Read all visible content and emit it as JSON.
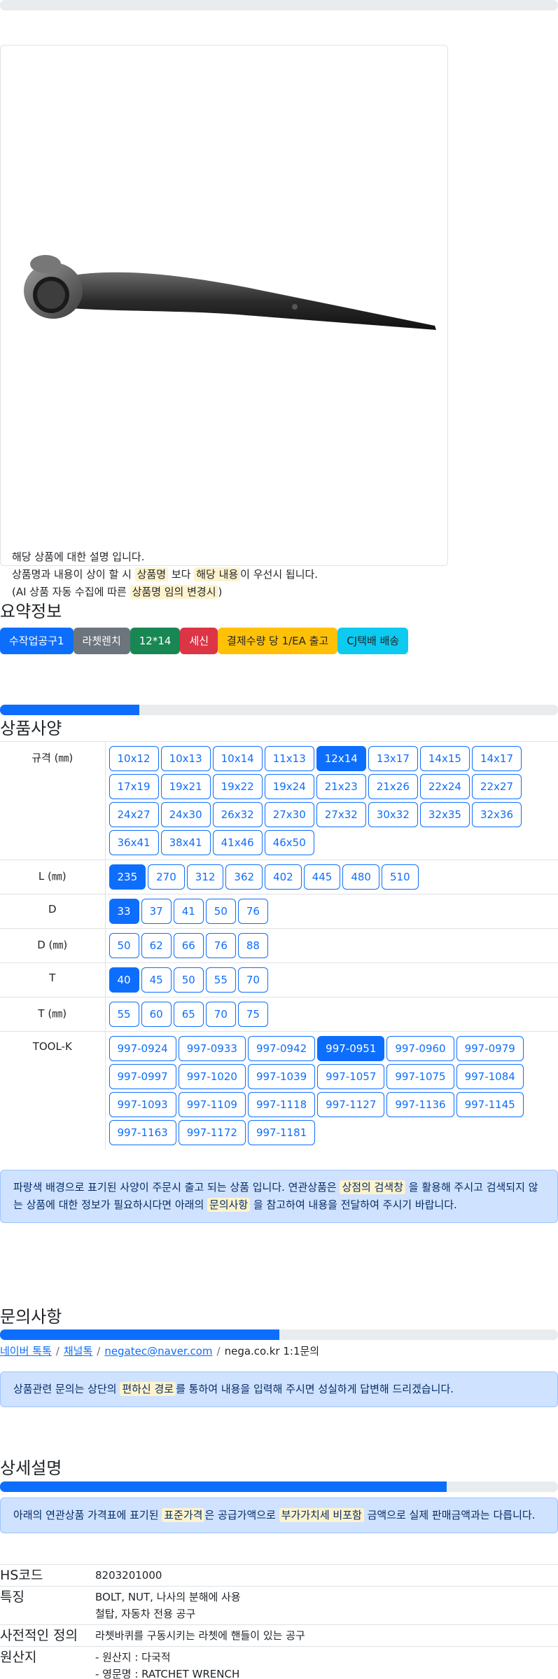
{
  "product": {
    "description_lines": [
      [
        "해당 상품에 대한 설명 입니다."
      ],
      [
        "상품명과 내용이 상이 할 시 ",
        {
          "hl": "상품명"
        },
        " 보다 ",
        {
          "hl": "해당 내용"
        },
        "이 우선시 됩니다."
      ],
      [
        "(AI 상품 자동 수집에 따른 ",
        {
          "hl": "상품명 임의 변경시"
        },
        ")"
      ]
    ]
  },
  "summary": {
    "title": "요약정보",
    "badges": [
      {
        "label": "수작업공구1",
        "style": "primary"
      },
      {
        "label": "라쳇렌치",
        "style": "secondary"
      },
      {
        "label": "12*14",
        "style": "success"
      },
      {
        "label": "세신",
        "style": "danger"
      },
      {
        "label": "결제수량 당 1/EA 출고",
        "style": "warning"
      },
      {
        "label": "CJ택배 배송",
        "style": "info"
      }
    ]
  },
  "specs": {
    "title": "상품사양",
    "progress": 0.25,
    "rows": [
      {
        "label": "규격 (㎜)",
        "options": [
          "10x12",
          "10x13",
          "10x14",
          "11x13",
          "12x14",
          "13x17",
          "14x15",
          "14x17",
          "17x19",
          "19x21",
          "19x22",
          "19x24",
          "21x23",
          "21x26",
          "22x24",
          "22x27",
          "24x27",
          "24x30",
          "26x32",
          "27x30",
          "27x32",
          "30x32",
          "32x35",
          "32x36",
          "36x41",
          "38x41",
          "41x46",
          "46x50"
        ],
        "selected": "12x14"
      },
      {
        "label": "L (㎜)",
        "options": [
          "235",
          "270",
          "312",
          "362",
          "402",
          "445",
          "480",
          "510"
        ],
        "selected": "235"
      },
      {
        "label": "D",
        "options": [
          "33",
          "37",
          "41",
          "50",
          "76"
        ],
        "selected": "33"
      },
      {
        "label": "D (㎜)",
        "options": [
          "50",
          "62",
          "66",
          "76",
          "88"
        ],
        "selected": ""
      },
      {
        "label": "T",
        "options": [
          "40",
          "45",
          "50",
          "55",
          "70"
        ],
        "selected": "40"
      },
      {
        "label": "T (㎜)",
        "options": [
          "55",
          "60",
          "65",
          "70",
          "75"
        ],
        "selected": ""
      },
      {
        "label": "TOOL-K",
        "options": [
          "997-0924",
          "997-0933",
          "997-0942",
          "997-0951",
          "997-0960",
          "997-0979",
          "997-0997",
          "997-1020",
          "997-1039",
          "997-1057",
          "997-1075",
          "997-1084",
          "997-1093",
          "997-1109",
          "997-1118",
          "997-1127",
          "997-1136",
          "997-1145",
          "997-1163",
          "997-1172",
          "997-1181"
        ],
        "selected": "997-0951"
      }
    ],
    "notice_parts": [
      "파랑색 배경으로 표기된 사양이 주문시 출고 되는 상품 입니다. 연관상품은 ",
      {
        "hl": "상점의 검색창"
      },
      " 을 활용해 주시고 검색되지 않는 상품에 대한 정보가 필요하시다면 아래의 ",
      {
        "hl": "문의사항"
      },
      " 을 참고하여 내용을 전달하여 주시기 바랍니다."
    ]
  },
  "inquiry": {
    "title": "문의사항",
    "progress": 0.5,
    "links": [
      "네이버 톡톡",
      "채널톡",
      "negatec@naver.com"
    ],
    "plain": "nega.co.kr 1:1문의",
    "notice_parts": [
      "상품관련 문의는 상단의 ",
      {
        "hl": "편하신 경로"
      },
      "를 통하여 내용을 입력해 주시면 성실하게 답변해 드리겠습니다."
    ]
  },
  "detail": {
    "title": "상세설명",
    "progress": 0.8,
    "notice_parts": [
      "아래의 연관상품 가격표에 표기된 ",
      {
        "hl": "표준가격"
      },
      "은 공급가액으로 ",
      {
        "hl": "부가가치세 비포함"
      },
      " 금액으로 실제 판매금액과는 다릅니다."
    ],
    "info": [
      {
        "key": "HS코드",
        "lines": [
          "8203201000"
        ]
      },
      {
        "key": "특징",
        "lines": [
          "BOLT, NUT, 나사의 분해에 사용",
          "철탑, 자동차 전용 공구"
        ]
      },
      {
        "key": "사전적인 정의",
        "lines": [
          "라쳇바퀴를 구동시키는 라쳇에 핸들이 있는 공구"
        ]
      },
      {
        "key": "원산지",
        "lines": [
          "- 원산지 : 다국적",
          "- 영문명 : RATCHET WRENCH"
        ]
      }
    ]
  },
  "colors": {
    "primary": "#0d6efd",
    "highlight": "#fff3cd",
    "alert_bg": "#cfe2ff"
  },
  "icons": {
    "product_image": "ratchet-wrench-image"
  }
}
